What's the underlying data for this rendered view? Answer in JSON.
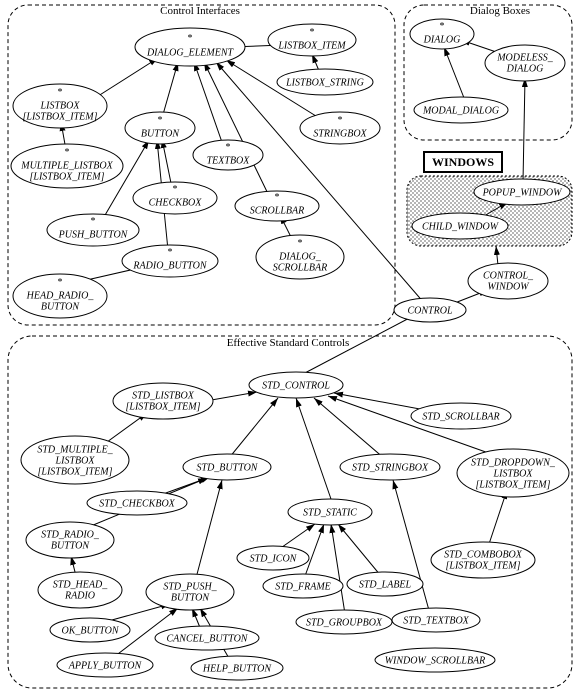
{
  "groups": {
    "ci": {
      "title": "Control Interfaces"
    },
    "db": {
      "title": "Dialog Boxes"
    },
    "win": {
      "title": "WINDOWS"
    },
    "esc": {
      "title": "Effective Standard Controls"
    }
  },
  "nodes": {
    "dialog_element": {
      "l1": "*",
      "l2": "DIALOG_ELEMENT"
    },
    "listbox_item": {
      "l1": "*",
      "l2": "LISTBOX_ITEM"
    },
    "listbox_string": {
      "l1": "LISTBOX_STRING"
    },
    "stringbox": {
      "l1": "*",
      "l2": "STRINGBOX"
    },
    "listbox": {
      "l1": "*",
      "l2": "LISTBOX",
      "l3": "[LISTBOX_ITEM]"
    },
    "multiple_listbox": {
      "l1": "*",
      "l2": "MULTIPLE_LISTBOX",
      "l3": "[LISTBOX_ITEM]"
    },
    "button": {
      "l1": "*",
      "l2": "BUTTON"
    },
    "textbox": {
      "l1": "*",
      "l2": "TEXTBOX"
    },
    "checkbox": {
      "l1": "*",
      "l2": "CHECKBOX"
    },
    "push_button": {
      "l1": "*",
      "l2": "PUSH_BUTTON"
    },
    "radio_button": {
      "l1": "*",
      "l2": "RADIO_BUTTON"
    },
    "head_radio_button": {
      "l1": "*",
      "l2": "HEAD_RADIO_",
      "l3": "BUTTON"
    },
    "scrollbar": {
      "l1": "*",
      "l2": "SCROLLBAR"
    },
    "dialog_scrollbar": {
      "l1": "*",
      "l2": "DIALOG_",
      "l3": "SCROLLBAR"
    },
    "dialog": {
      "l1": "*",
      "l2": "DIALOG"
    },
    "modeless_dialog": {
      "l1": "MODELESS_",
      "l2": "DIALOG"
    },
    "modal_dialog": {
      "l1": "MODAL_DIALOG"
    },
    "popup_window": {
      "l1": "POPUP_WINDOW"
    },
    "child_window": {
      "l1": "CHILD_WINDOW"
    },
    "control_window": {
      "l1": "CONTROL_",
      "l2": "WINDOW"
    },
    "control": {
      "l1": "CONTROL"
    },
    "std_control": {
      "l1": "STD_CONTROL"
    },
    "std_listbox": {
      "l1": "STD_LISTBOX",
      "l2": "[LISTBOX_ITEM]"
    },
    "std_scrollbar": {
      "l1": "STD_SCROLLBAR"
    },
    "std_multiple_listbox": {
      "l1": "STD_MULTIPLE_",
      "l2": "LISTBOX",
      "l3": "[LISTBOX_ITEM]"
    },
    "std_button": {
      "l1": "STD_BUTTON"
    },
    "std_stringbox": {
      "l1": "STD_STRINGBOX"
    },
    "std_dropdown_listbox": {
      "l1": "STD_DROPDOWN_",
      "l2": "LISTBOX",
      "l3": "[LISTBOX_ITEM]"
    },
    "std_checkbox": {
      "l1": "STD_CHECKBOX"
    },
    "std_radio_button": {
      "l1": "STD_RADIO_",
      "l2": "BUTTON"
    },
    "std_static": {
      "l1": "STD_STATIC"
    },
    "std_combobox": {
      "l1": "STD_COMBOBOX",
      "l2": "[LISTBOX_ITEM]"
    },
    "std_head_radio": {
      "l1": "STD_HEAD_",
      "l2": "RADIO"
    },
    "std_push_button": {
      "l1": "STD_PUSH_",
      "l2": "BUTTON"
    },
    "std_icon": {
      "l1": "STD_ICON"
    },
    "std_frame": {
      "l1": "STD_FRAME"
    },
    "std_label": {
      "l1": "STD_LABEL"
    },
    "std_groupbox": {
      "l1": "STD_GROUPBOX"
    },
    "std_textbox": {
      "l1": "STD_TEXTBOX"
    },
    "ok_button": {
      "l1": "OK_BUTTON"
    },
    "cancel_button": {
      "l1": "CANCEL_BUTTON"
    },
    "apply_button": {
      "l1": "APPLY_BUTTON"
    },
    "help_button": {
      "l1": "HELP_BUTTON"
    },
    "window_scrollbar": {
      "l1": "WINDOW_SCROLLBAR"
    }
  }
}
